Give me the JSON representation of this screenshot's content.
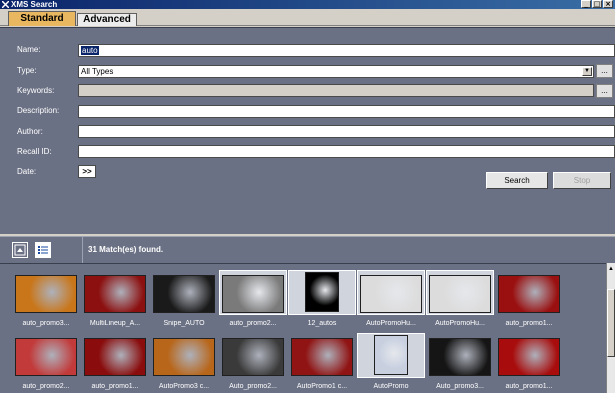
{
  "window": {
    "title": "XMS Search",
    "minimize": "_",
    "maximize": "□",
    "close": "×"
  },
  "tabs": [
    {
      "label": "Standard",
      "active": true
    },
    {
      "label": "Advanced",
      "active": false
    }
  ],
  "form": {
    "name_label": "Name:",
    "name_value": "auto",
    "type_label": "Type:",
    "type_value": "All Types",
    "keywords_label": "Keywords:",
    "keywords_value": "",
    "description_label": "Description:",
    "description_value": "",
    "author_label": "Author:",
    "author_value": "",
    "recall_label": "Recall ID:",
    "recall_value": "",
    "date_label": "Date:",
    "date_button": ">>",
    "ellipsis": "...",
    "search_button": "Search",
    "stop_button": "Stop"
  },
  "results": {
    "match_text": "31 Match(es) found.",
    "thumbnails": [
      {
        "label": "auto_promo3...",
        "color": "#c9761a"
      },
      {
        "label": "MultiLineup_A...",
        "color": "#8c1010"
      },
      {
        "label": "Snipe_AUTO",
        "color": "#1a1a1a"
      },
      {
        "label": "auto_promo2...",
        "color": "#7a7a7a"
      },
      {
        "label": "12_autos",
        "color": "#000000"
      },
      {
        "label": "AutoPromoHu...",
        "color": "#dcdcdc"
      },
      {
        "label": "AutoPromoHu...",
        "color": "#dcdcdc"
      },
      {
        "label": "auto_promo1...",
        "color": "#9a1010"
      },
      {
        "label": "auto_promo2...",
        "color": "#c23a3a"
      },
      {
        "label": "auto_promo1...",
        "color": "#8a0c0c"
      },
      {
        "label": "AutoPromo3 c...",
        "color": "#b8661a"
      },
      {
        "label": "Auto_promo2...",
        "color": "#3a3a3a"
      },
      {
        "label": "AutoPromo1 c...",
        "color": "#901414"
      },
      {
        "label": "AutoPromo",
        "color": "#c8d0e0"
      },
      {
        "label": "Auto_promo3...",
        "color": "#151515"
      },
      {
        "label": "auto_promo1...",
        "color": "#a80c0c"
      }
    ]
  }
}
